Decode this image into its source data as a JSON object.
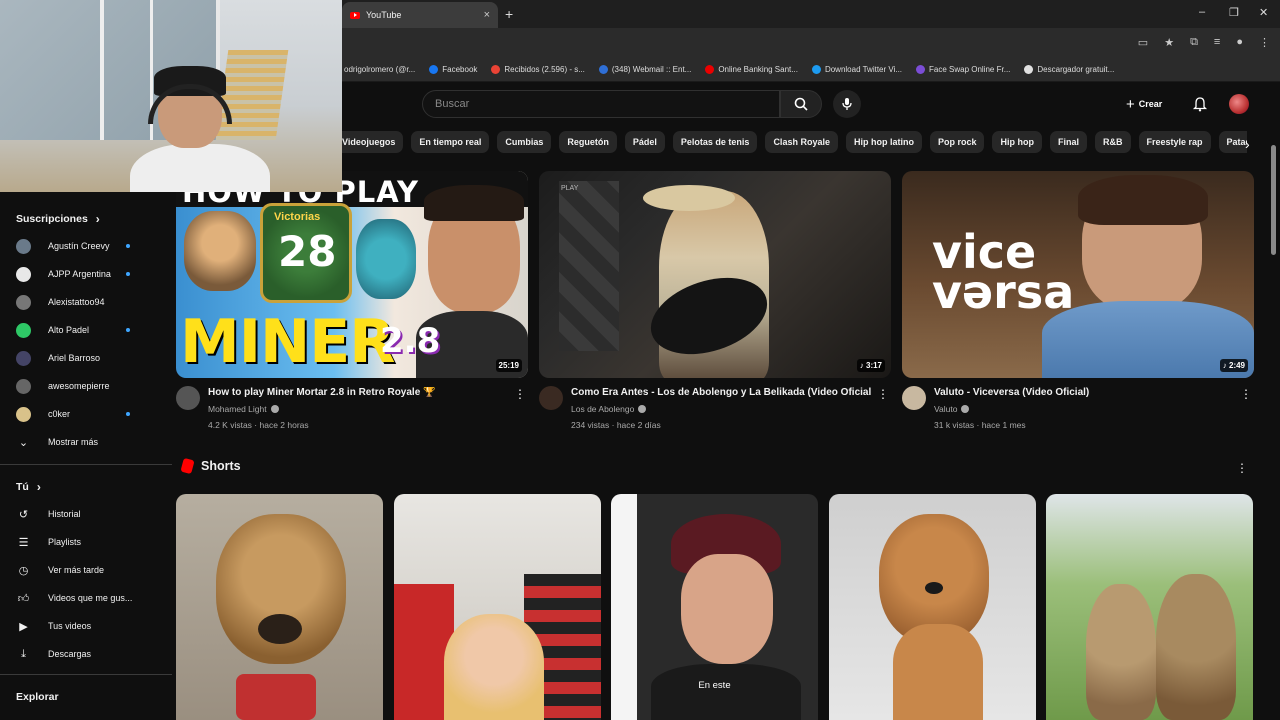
{
  "browser": {
    "tab_title": "YouTube",
    "tab_close": "×",
    "new_tab": "+",
    "window_controls": [
      "–",
      "❐",
      "✕"
    ],
    "address_icons": [
      "cast-icon",
      "star-icon",
      "extensions-icon",
      "media-icon",
      "profile-icon",
      "menu-icon"
    ],
    "bookmarks": [
      {
        "label": "odrigolromero (@r...",
        "color": "#888888"
      },
      {
        "label": "Facebook",
        "color": "#1877f2"
      },
      {
        "label": "Recibidos (2.596) - s...",
        "color": "#ea4335"
      },
      {
        "label": "(348) Webmail :: Ent...",
        "color": "#2f6fd6"
      },
      {
        "label": "Online Banking Sant...",
        "color": "#ec0000"
      },
      {
        "label": "Download Twitter Vi...",
        "color": "#1d9bf0"
      },
      {
        "label": "Face Swap Online Fr...",
        "color": "#7b4dd6"
      },
      {
        "label": "Descargador gratuit...",
        "color": "#e0e0e0"
      }
    ]
  },
  "masthead": {
    "search_placeholder": "Buscar",
    "create_label": "Crear"
  },
  "chips": [
    "Videojuegos",
    "En tiempo real",
    "Cumbias",
    "Reguetón",
    "Pádel",
    "Pelotas de tenis",
    "Clash Royale",
    "Hip hop latino",
    "Pop rock",
    "Hip hop",
    "Final",
    "R&B",
    "Freestyle rap",
    "Patadas"
  ],
  "sidebar": {
    "subscriptions_title": "Suscripciones",
    "subscriptions": [
      {
        "name": "Agustín Creevy",
        "color": "#6a7a8a",
        "new": true
      },
      {
        "name": "AJPP Argentina",
        "color": "#e8e8e8",
        "new": true
      },
      {
        "name": "Alexistattoo94",
        "color": "#777777",
        "new": false
      },
      {
        "name": "Alto Padel",
        "color": "#2ec866",
        "new": true
      },
      {
        "name": "Ariel Barroso",
        "color": "#444466",
        "new": false
      },
      {
        "name": "awesomepierre",
        "color": "#666666",
        "new": false
      },
      {
        "name": "c0ker",
        "color": "#d9c28a",
        "new": true
      }
    ],
    "show_more": "Mostrar más",
    "you_title": "Tú",
    "you_items": [
      {
        "label": "Historial",
        "icon": "history-icon"
      },
      {
        "label": "Playlists",
        "icon": "playlists-icon"
      },
      {
        "label": "Ver más tarde",
        "icon": "watch-later-icon"
      },
      {
        "label": "Videos que me gus...",
        "icon": "like-icon"
      },
      {
        "label": "Tus videos",
        "icon": "your-videos-icon"
      },
      {
        "label": "Descargas",
        "icon": "download-icon"
      }
    ],
    "explore_title": "Explorar"
  },
  "videos": [
    {
      "title": "How to play Miner Mortar 2.8 in Retro Royale 🏆",
      "channel": "Mohamed Light",
      "meta": "4.2 K vistas · hace 2 horas",
      "duration": "25:19",
      "thumb_text_top": "HOW TO PLAY",
      "thumb_text_mid": "Victorias",
      "thumb_number": "28",
      "thumb_text_big": "MINER",
      "thumb_badge": "2.8"
    },
    {
      "title": "Como Era Antes - Los de Abolengo y La Belikada (Video Oficial)",
      "channel": "Los de Abolengo",
      "meta": "234 vistas · hace 2 días",
      "duration": "♪ 3:17",
      "thumb_text_top": "PLAY"
    },
    {
      "title": "Valuto - Viceversa (Video Oficial)",
      "channel": "Valuto",
      "meta": "31 k vistas · hace 1 mes",
      "duration": "♪ 2:49",
      "thumb_text_top": "vice",
      "thumb_text_big": "vərsa"
    }
  ],
  "shorts": {
    "title": "Shorts",
    "caption_3": "En este"
  }
}
